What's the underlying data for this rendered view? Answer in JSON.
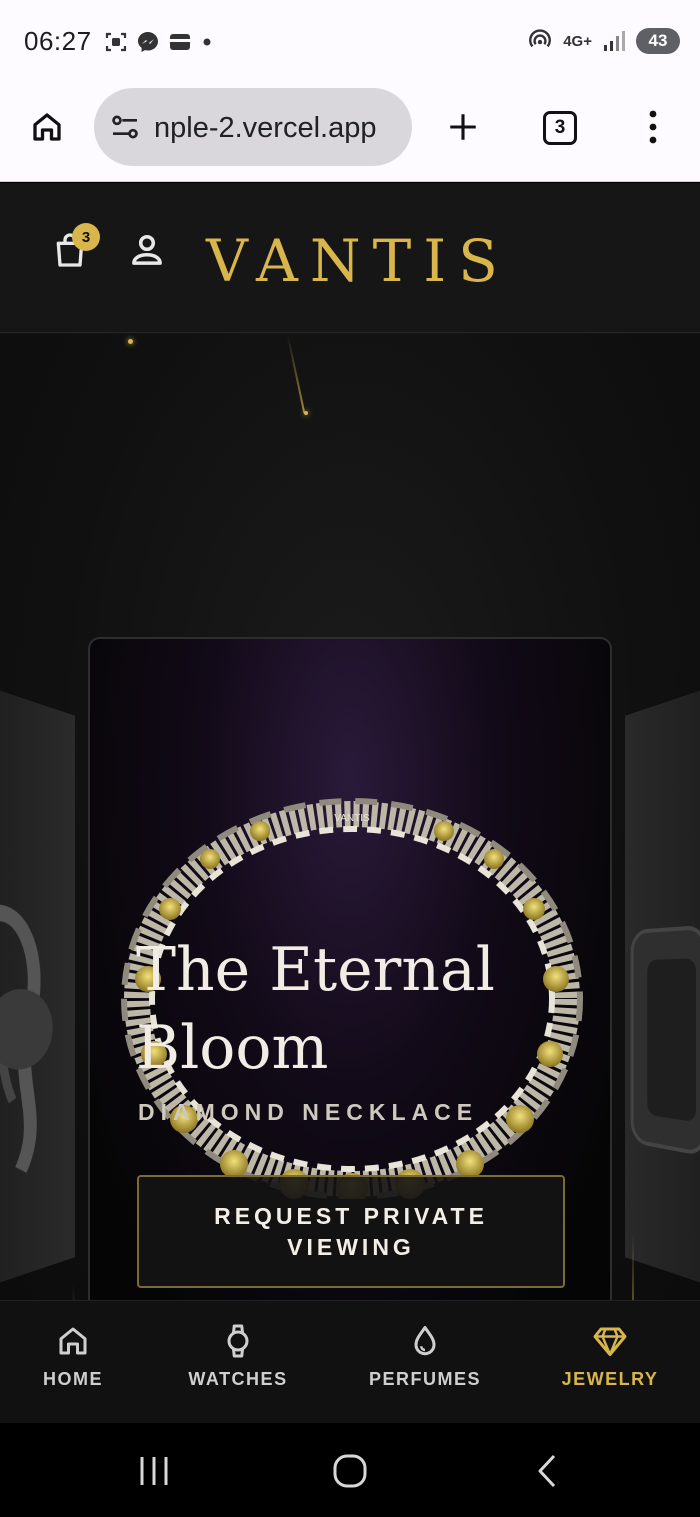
{
  "status_bar": {
    "time": "06:27",
    "network": "4G+",
    "battery": "43",
    "icons": [
      "screenshot-icon",
      "messenger-icon",
      "wallet-icon",
      "dot-icon",
      "hotspot-icon",
      "signal-icon"
    ]
  },
  "browser": {
    "url": "nple-2.vercel.app",
    "tab_count": "3",
    "icons": [
      "home-icon",
      "site-settings-icon",
      "new-tab-icon",
      "more-icon"
    ]
  },
  "site": {
    "brand": "VANTIS",
    "cart_count": "3",
    "accent_color": "#d9b64b",
    "featured": {
      "title_line1": "The Eternal",
      "title_line2": "Bloom",
      "subtitle": "DIAMOND NECKLACE",
      "cta_label": "REQUEST PRIVATE VIEWING"
    }
  },
  "bottom_nav": {
    "items": [
      {
        "label": "HOME",
        "icon": "home-icon",
        "active": false
      },
      {
        "label": "WATCHES",
        "icon": "watch-icon",
        "active": false
      },
      {
        "label": "PERFUMES",
        "icon": "drop-icon",
        "active": false
      },
      {
        "label": "JEWELRY",
        "icon": "diamond-icon",
        "active": true
      }
    ]
  }
}
